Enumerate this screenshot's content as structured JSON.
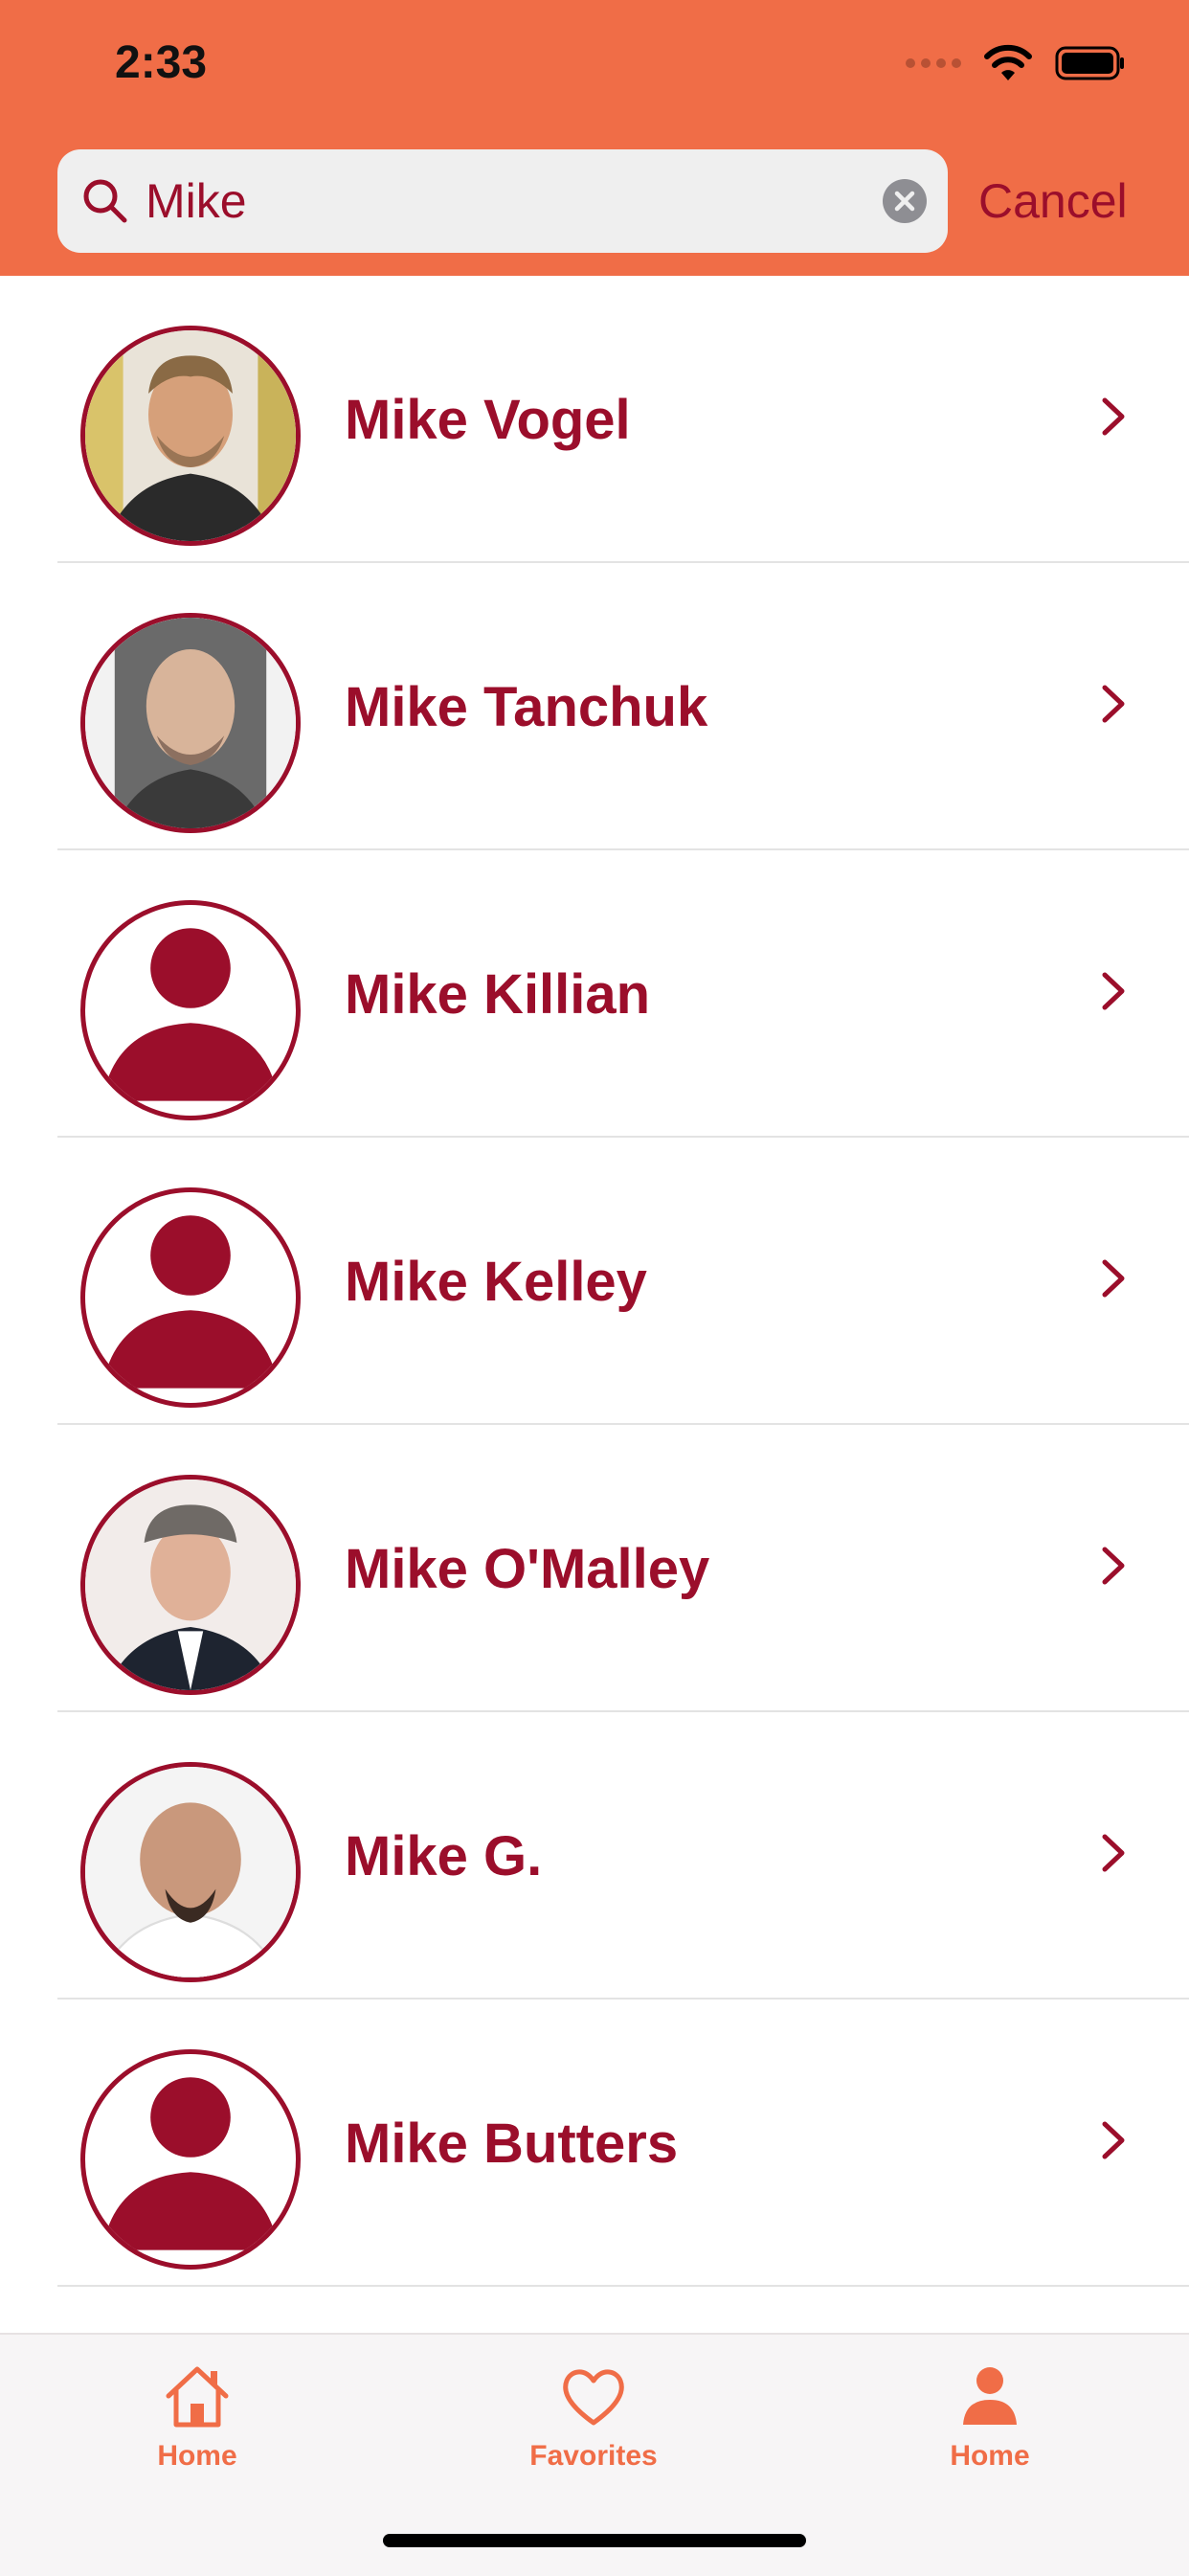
{
  "status_bar": {
    "time": "2:33"
  },
  "search": {
    "query": "Mike",
    "cancel_label": "Cancel"
  },
  "results": [
    {
      "name": "Mike Vogel",
      "avatar": "photo"
    },
    {
      "name": "Mike Tanchuk",
      "avatar": "photo"
    },
    {
      "name": "Mike Killian",
      "avatar": "placeholder"
    },
    {
      "name": "Mike Kelley",
      "avatar": "placeholder"
    },
    {
      "name": "Mike O'Malley",
      "avatar": "photo"
    },
    {
      "name": "Mike G.",
      "avatar": "photo"
    },
    {
      "name": "Mike Butters",
      "avatar": "placeholder"
    }
  ],
  "tabs": [
    {
      "label": "Home",
      "icon": "house-icon"
    },
    {
      "label": "Favorites",
      "icon": "heart-icon"
    },
    {
      "label": "Home",
      "icon": "person-icon"
    }
  ],
  "colors": {
    "accent": "#F06D47",
    "primary": "#9B0E2B",
    "search_bg": "#EFEFEF"
  }
}
